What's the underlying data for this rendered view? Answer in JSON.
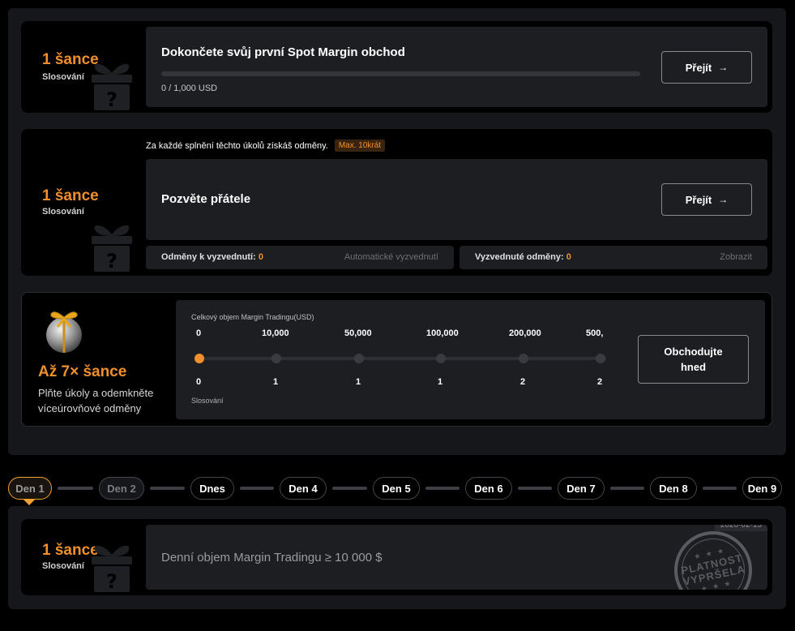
{
  "task1": {
    "chances": "1 šance",
    "slos": "Slosování",
    "title": "Dokončete svůj první Spot Margin obchod",
    "progress_text": "0 / 1,000 USD",
    "progress": 0,
    "button": "Přejít"
  },
  "task2": {
    "note": "Za každé splnění těchto úkolů získáš odměny.",
    "tag": "Max. 10krát",
    "chances": "1 šance",
    "slos": "Slosování",
    "title": "Pozvěte přátele",
    "button": "Přejít",
    "claimable_label": "Odměny k vyzvednutí:",
    "claimable_value": "0",
    "auto_claim": "Automatické vyzvednutí",
    "claimed_label": "Vyzvednuté odměny:",
    "claimed_value": "0",
    "show": "Zobrazit"
  },
  "tiered": {
    "chances": "Až 7× šance",
    "desc": "Plňte úkoly a odemkněte víceúrovňové odměny",
    "axis_label": "Celkový objem Margin Tradingu(USD)",
    "levels": [
      "0",
      "10,000",
      "50,000",
      "100,000",
      "200,000",
      "500,"
    ],
    "draws": [
      "0",
      "1",
      "1",
      "1",
      "2",
      "2"
    ],
    "draw_label": "Slosování",
    "button": "Obchodujte hned"
  },
  "days": [
    {
      "label": "Den 1",
      "state": "active"
    },
    {
      "label": "Den 2",
      "state": "dim"
    },
    {
      "label": "Dnes",
      "state": "normal"
    },
    {
      "label": "Den 4",
      "state": "normal"
    },
    {
      "label": "Den 5",
      "state": "normal"
    },
    {
      "label": "Den 6",
      "state": "normal"
    },
    {
      "label": "Den 7",
      "state": "normal"
    },
    {
      "label": "Den 8",
      "state": "normal"
    },
    {
      "label": "Den 9",
      "state": "normal"
    }
  ],
  "daily": {
    "chances": "1 šance",
    "slos": "Slosování",
    "title": "Denní objem Margin Tradingu ≥ 10 000 $",
    "date": "2026-02-15",
    "stamp_line1": "PLATNOST",
    "stamp_line2": "VYPRŠELA"
  }
}
